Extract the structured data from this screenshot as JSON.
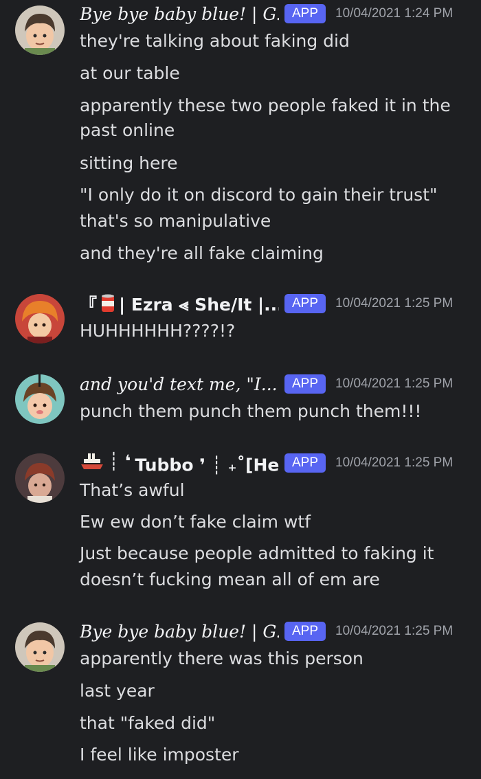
{
  "messages": [
    {
      "username": "Bye bye baby blue! | G...",
      "badge": "APP",
      "timestamp": "10/04/2021 1:24 PM",
      "lines": [
        "they're talking about faking did",
        "at our table",
        "apparently these two people faked it in the",
        "past online",
        "sitting here",
        "\"I only do it on discord to gain their trust\"",
        "that's so manipulative",
        "and they're all fake claiming"
      ]
    },
    {
      "username_prefix": "『",
      "username": "| Ezra ⪡ She/It |...",
      "badge": "APP",
      "timestamp": "10/04/2021 1:25 PM",
      "lines": [
        "HUHHHHHH????!?"
      ]
    },
    {
      "username": "and you'd text me, \"I...",
      "badge": "APP",
      "timestamp": "10/04/2021 1:25 PM",
      "lines": [
        "punch them punch them punch them!!!"
      ]
    },
    {
      "username_prefix": "┊ ❛",
      "username": "Tubbo ❜ ┊ ₊˚[He...",
      "badge": "APP",
      "timestamp": "10/04/2021 1:25 PM",
      "lines": [
        "That’s awful",
        "Ew ew don’t fake claim wtf",
        "Just because people admitted to faking it",
        "doesn’t fucking mean all of em are"
      ]
    },
    {
      "username": "Bye bye baby blue! | G...",
      "badge": "APP",
      "timestamp": "10/04/2021 1:25 PM",
      "lines": [
        "apparently there was this person",
        "last year",
        "that \"faked did\"",
        "I feel like imposter"
      ]
    }
  ],
  "colors": {
    "background": "#1e1f22",
    "badge": "#5865f2",
    "username": "#f2f3f5",
    "message": "#dcdde0",
    "timestamp": "#a0a3aa"
  },
  "icons": [
    "soup-can-icon",
    "ship-icon"
  ]
}
